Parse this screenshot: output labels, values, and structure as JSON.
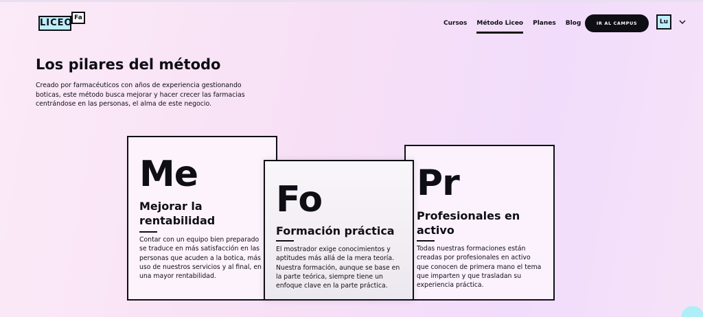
{
  "brand": {
    "logo_main": "LICEO",
    "logo_sup": "Fa"
  },
  "nav": {
    "items": [
      {
        "label": "Cursos"
      },
      {
        "label": "Método Liceo"
      },
      {
        "label": "Planes"
      },
      {
        "label": "Blog"
      }
    ],
    "active_index": 1,
    "cta_label": "IR AL CAMPUS",
    "avatar_initials": "Lu"
  },
  "intro": {
    "title": "Los pilares del método",
    "text": "Creado por farmacéuticos con años de experiencia gestionando boticas, este método busca mejorar y hacer crecer las farmacias centrándose en las personas, el alma de este negocio."
  },
  "cards": [
    {
      "symbol": "Me",
      "title": "Mejorar la rentabilidad",
      "text": "Contar con un equipo bien preparado se traduce en más satisfacción en las personas que acuden a la botica, más uso de nuestros servicios y al final, en una mayor rentabilidad."
    },
    {
      "symbol": "Fo",
      "title": "Formación práctica",
      "text": "El mostrador exige conocimientos y aptitudes más allá de la mera teoría. Nuestra formación, aunque se base en la parte teórica, siempre tiene un enfoque clave en la parte práctica."
    },
    {
      "symbol": "Pr",
      "title": "Profesionales en activo",
      "text": "Todas nuestras formaciones están creadas por profesionales en activo que conocen de primera mano el tema que imparten y que trasladan su experiencia práctica."
    }
  ],
  "colors": {
    "ink": "#0e0e14",
    "accent_cyan": "#bdeefa",
    "background_pink": "#f7e0f6"
  },
  "icons": {
    "avatar_dropdown": "chevron-down-icon"
  }
}
